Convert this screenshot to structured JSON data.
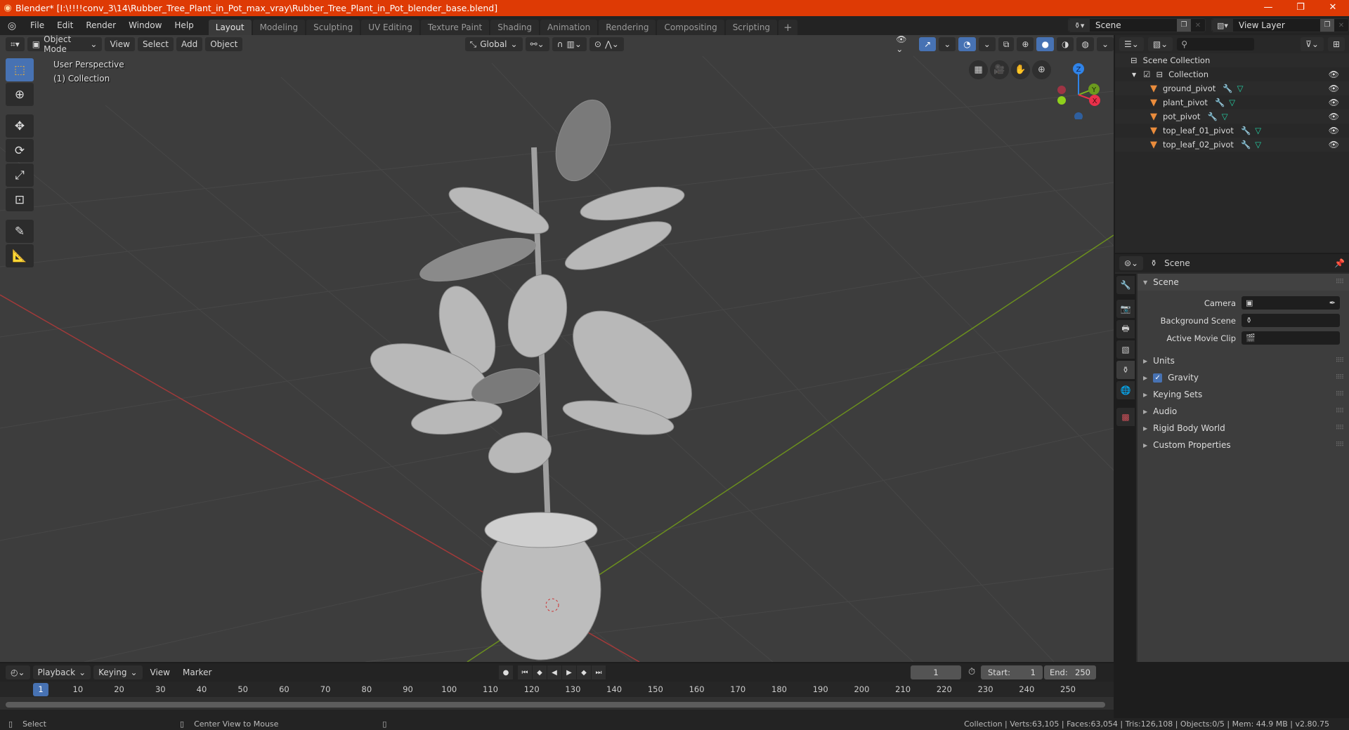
{
  "window": {
    "title": "Blender* [I:\\!!!!conv_3\\14\\Rubber_Tree_Plant_in_Pot_max_vray\\Rubber_Tree_Plant_in_Pot_blender_base.blend]",
    "controls": {
      "minimize": "—",
      "maximize": "❐",
      "close": "✕"
    }
  },
  "menu": [
    "File",
    "Edit",
    "Render",
    "Window",
    "Help"
  ],
  "workspaces": [
    "Layout",
    "Modeling",
    "Sculpting",
    "UV Editing",
    "Texture Paint",
    "Shading",
    "Animation",
    "Rendering",
    "Compositing",
    "Scripting"
  ],
  "active_workspace": "Layout",
  "workspace_add": "+",
  "scene_selector": {
    "value": "Scene"
  },
  "view_layer_selector": {
    "value": "View Layer"
  },
  "viewport": {
    "mode": "Object Mode",
    "menus": [
      "View",
      "Select",
      "Add",
      "Object"
    ],
    "orientation": "Global",
    "perspective_label": "User Perspective",
    "collection_label": "(1) Collection",
    "gizmo_axes": {
      "z": "Z",
      "y": "Y",
      "x": "X"
    },
    "colors": {
      "background": "#3d3d3d",
      "x_axis": "#e8304a",
      "y_axis": "#7cb61e",
      "z_axis": "#2f83e8",
      "active": "#4772b3"
    }
  },
  "tools": [
    "select-box",
    "cursor",
    "move",
    "rotate",
    "scale",
    "transform",
    "annotate",
    "measure"
  ],
  "outliner": {
    "search_placeholder": "",
    "root": "Scene Collection",
    "collection": "Collection",
    "items": [
      {
        "name": "ground_pivot"
      },
      {
        "name": "plant_pivot"
      },
      {
        "name": "pot_pivot"
      },
      {
        "name": "top_leaf_01_pivot"
      },
      {
        "name": "top_leaf_02_pivot"
      }
    ]
  },
  "properties": {
    "context": "Scene",
    "panel_title": "Scene",
    "fields": [
      {
        "label": "Camera",
        "value": ""
      },
      {
        "label": "Background Scene",
        "value": ""
      },
      {
        "label": "Active Movie Clip",
        "value": ""
      }
    ],
    "subpanels": [
      {
        "label": "Units"
      },
      {
        "label": "Gravity",
        "checked": true
      },
      {
        "label": "Keying Sets"
      },
      {
        "label": "Audio"
      },
      {
        "label": "Rigid Body World"
      },
      {
        "label": "Custom Properties"
      }
    ]
  },
  "timeline": {
    "menus": [
      "Playback",
      "Keying",
      "View",
      "Marker"
    ],
    "current_frame": "1",
    "start_label": "Start:",
    "start": "1",
    "end_label": "End:",
    "end": "250",
    "ruler": [
      "10",
      "20",
      "30",
      "40",
      "50",
      "60",
      "70",
      "80",
      "90",
      "100",
      "110",
      "120",
      "130",
      "140",
      "150",
      "160",
      "170",
      "180",
      "190",
      "200",
      "210",
      "220",
      "230",
      "240",
      "250"
    ]
  },
  "statusbar": {
    "left_action": "Select",
    "middle_action": "Center View to Mouse",
    "stats": "Collection | Verts:63,105 | Faces:63,054 | Tris:126,108 | Objects:0/5 | Mem: 44.9 MB | v2.80.75"
  }
}
